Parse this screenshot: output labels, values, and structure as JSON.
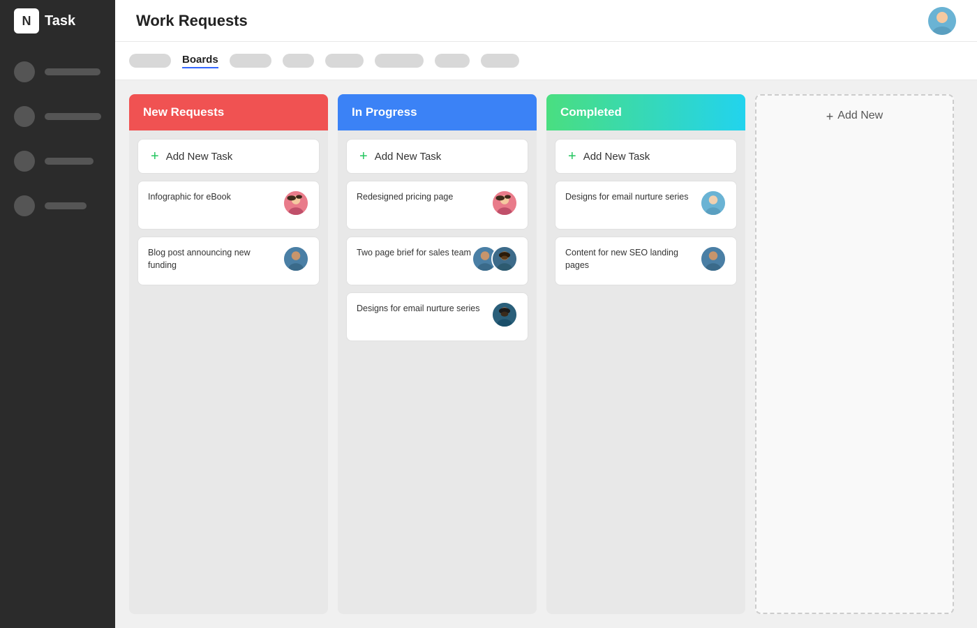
{
  "app": {
    "logo_text": "Task",
    "logo_icon": "N"
  },
  "header": {
    "title": "Work Requests"
  },
  "tabs": {
    "active": "Boards",
    "inactive_pills": [
      1,
      2,
      3,
      4,
      5,
      6,
      7
    ]
  },
  "sidebar": {
    "items": [
      {
        "id": 1,
        "line_width": 80
      },
      {
        "id": 2,
        "line_width": 95
      },
      {
        "id": 3,
        "line_width": 70
      },
      {
        "id": 4,
        "line_width": 60
      }
    ]
  },
  "columns": [
    {
      "id": "new-requests",
      "title": "New Requests",
      "color_class": "red",
      "add_task_label": "Add New Task",
      "tasks": [
        {
          "text": "Infographic for eBook",
          "avatars": [
            "av1"
          ]
        },
        {
          "text": "Blog post announcing new funding",
          "avatars": [
            "av3"
          ]
        }
      ]
    },
    {
      "id": "in-progress",
      "title": "In Progress",
      "color_class": "blue",
      "add_task_label": "Add New Task",
      "tasks": [
        {
          "text": "Redesigned pricing page",
          "avatars": [
            "av1"
          ]
        },
        {
          "text": "Two page brief for sales team",
          "avatars": [
            "av3",
            "av4"
          ]
        },
        {
          "text": "Designs for email nurture series",
          "avatars": [
            "av5"
          ]
        }
      ]
    },
    {
      "id": "completed",
      "title": "Completed",
      "color_class": "green",
      "add_task_label": "Add New Task",
      "tasks": [
        {
          "text": "Designs for email nurture series",
          "avatars": [
            "av2"
          ]
        },
        {
          "text": "Content for new SEO landing pages",
          "avatars": [
            "av3"
          ]
        }
      ]
    }
  ],
  "add_new": {
    "label": "Add New",
    "plus": "+"
  }
}
